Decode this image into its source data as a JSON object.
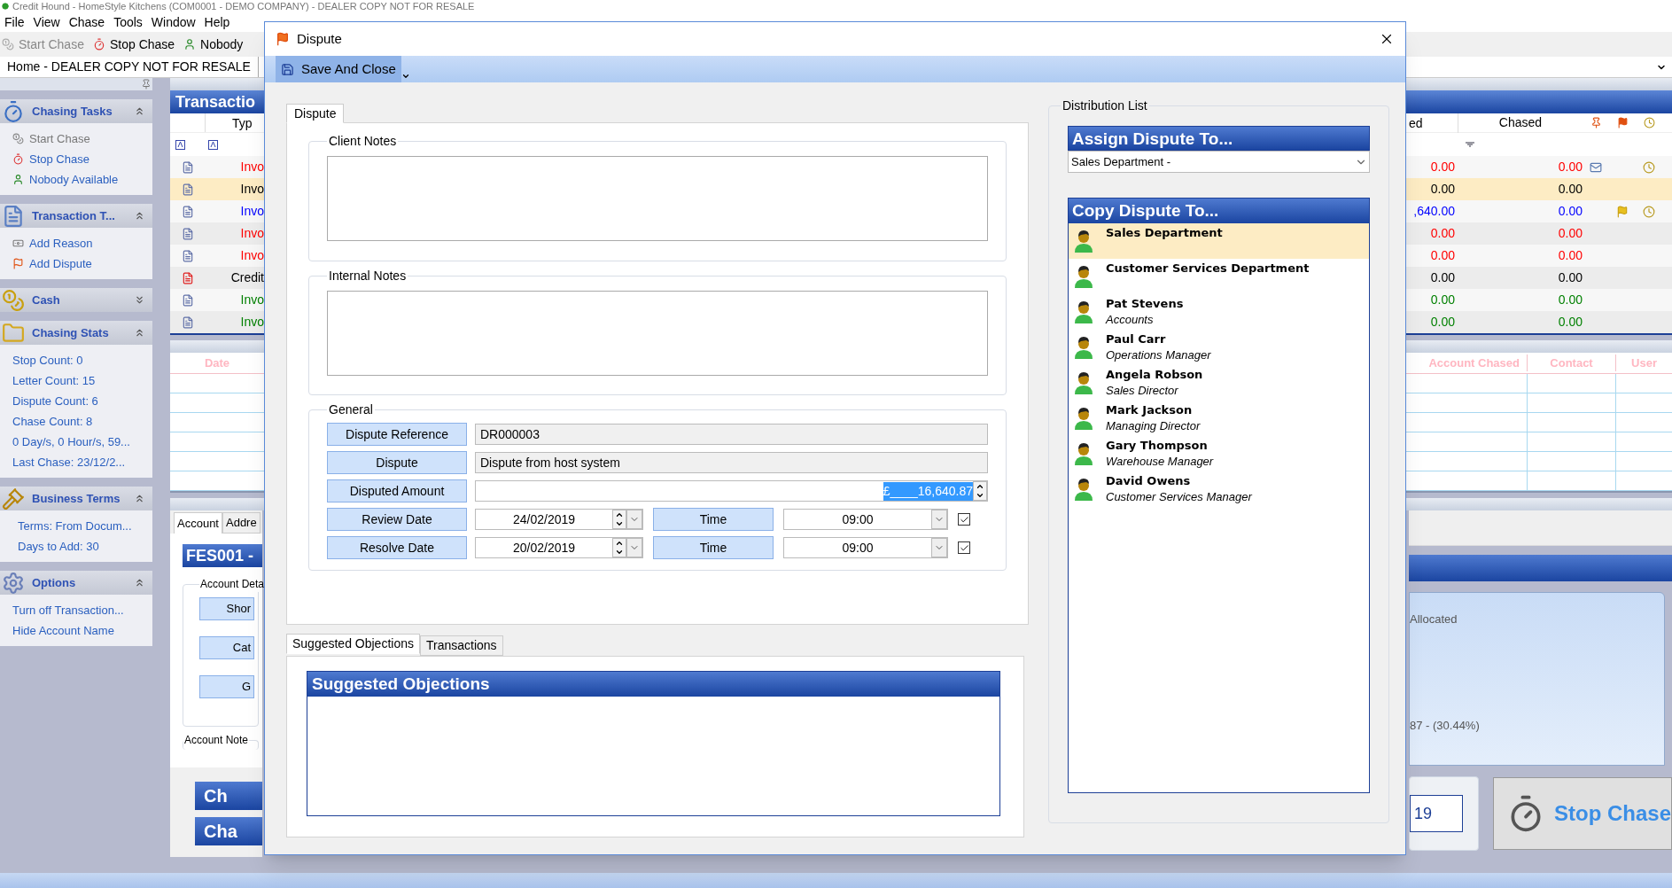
{
  "app_title": "Credit Hound - HomeStyle Kitchens (COM0001 - DEMO COMPANY) - DEALER COPY NOT FOR RESALE",
  "menu": [
    "File",
    "View",
    "Chase",
    "Tools",
    "Window",
    "Help"
  ],
  "toolbar": [
    {
      "label": "Start Chase",
      "disabled": true
    },
    {
      "label": "Stop Chase",
      "disabled": false
    },
    {
      "label": "Nobody",
      "disabled": false
    }
  ],
  "document_tab": "Home - DEALER COPY NOT FOR RESALE",
  "sidebar": [
    {
      "title": "Chasing Tasks",
      "expanded": true,
      "items": [
        {
          "label": "Start Chase",
          "disabled": true
        },
        {
          "label": "Stop Chase",
          "disabled": false
        },
        {
          "label": "Nobody Available",
          "disabled": false
        }
      ]
    },
    {
      "title": "Transaction  T...",
      "expanded": true,
      "items": [
        {
          "label": "Add Reason",
          "disabled": false
        },
        {
          "label": "Add Dispute",
          "disabled": false
        }
      ]
    },
    {
      "title": "Cash",
      "expanded": false
    },
    {
      "title": "Chasing Stats",
      "expanded": true,
      "items": [
        {
          "label": "Stop Count: 0",
          "disabled": false
        },
        {
          "label": "Letter Count: 15",
          "disabled": false
        },
        {
          "label": "Dispute Count: 6",
          "disabled": false
        },
        {
          "label": "Chase Count: 8",
          "disabled": false
        },
        {
          "label": "0 Day/s, 0 Hour/s, 59...",
          "disabled": false
        },
        {
          "label": "Last Chase: 23/12/2...",
          "disabled": false
        }
      ]
    },
    {
      "title": "Business Terms",
      "expanded": true,
      "items": [
        {
          "label": "Terms: From Docum...",
          "disabled": false
        },
        {
          "label": "Days to Add: 30",
          "disabled": false
        }
      ]
    },
    {
      "title": "Options",
      "expanded": true,
      "items": [
        {
          "label": "Turn off Transaction...",
          "disabled": false
        },
        {
          "label": "Hide Account Name",
          "disabled": false
        }
      ]
    }
  ],
  "transactions": {
    "title": "Transactio",
    "columns_left": [
      "Typ"
    ],
    "columns_right": [
      "ed",
      "Chased"
    ],
    "rows": [
      {
        "kind": "invoice",
        "type": "Invo",
        "amount": "0.00",
        "chased": "0.00",
        "color": "#ff0000",
        "selected": false,
        "emailed": true,
        "flagged": false,
        "reminder": true
      },
      {
        "kind": "invoice",
        "type": "Invo",
        "amount": "0.00",
        "chased": "0.00",
        "color": "#000000",
        "selected": true,
        "emailed": false,
        "flagged": false,
        "reminder": false
      },
      {
        "kind": "invoice",
        "type": "Invo",
        "amount": ",640.00",
        "chased": "0.00",
        "color": "#0000ff",
        "selected": false,
        "emailed": false,
        "flagged": true,
        "reminder": true
      },
      {
        "kind": "invoice",
        "type": "Invo",
        "amount": "0.00",
        "chased": "0.00",
        "color": "#ff0000",
        "selected": false,
        "emailed": false,
        "flagged": false,
        "reminder": false
      },
      {
        "kind": "invoice",
        "type": "Invo",
        "amount": "0.00",
        "chased": "0.00",
        "color": "#ff0000",
        "selected": false,
        "emailed": false,
        "flagged": false,
        "reminder": false
      },
      {
        "kind": "credit",
        "type": "Credit",
        "amount": "0.00",
        "chased": "0.00",
        "color": "#000000",
        "selected": false,
        "emailed": false,
        "flagged": false,
        "reminder": false
      },
      {
        "kind": "invoice",
        "type": "Invo",
        "amount": "0.00",
        "chased": "0.00",
        "color": "#008000",
        "selected": false,
        "emailed": false,
        "flagged": false,
        "reminder": false
      },
      {
        "kind": "invoice",
        "type": "Invo",
        "amount": "0.00",
        "chased": "0.00",
        "color": "#008000",
        "selected": false,
        "emailed": false,
        "flagged": false,
        "reminder": false
      }
    ]
  },
  "history": {
    "columns_left": [
      "Date"
    ],
    "columns_right": [
      "Account Chased",
      "Contact",
      "User"
    ]
  },
  "account": {
    "tabs": [
      {
        "label": "Account",
        "selected": true
      },
      {
        "label": "Addre",
        "selected": false
      }
    ],
    "header": "FES001 -",
    "group": "Account Deta",
    "fields": [
      "Shor",
      "Cat",
      "G"
    ],
    "notes_group": "Account Note",
    "buttons": [
      "Ch",
      "Cha"
    ],
    "allocated": "Allocated",
    "percent": "87 - (30.44%)",
    "date_box": "19",
    "stop_button": "Stop Chase"
  },
  "dialog": {
    "title": "Dispute",
    "toolbar_button": "Save And Close",
    "tabs": [
      {
        "label": "Dispute",
        "selected": true
      }
    ],
    "client_notes": "Client Notes",
    "internal_notes": "Internal Notes",
    "general": "General",
    "rows": [
      {
        "kind": "text",
        "label": "Dispute Reference",
        "value": "DR000003"
      },
      {
        "kind": "text",
        "label": "Dispute",
        "value": "Dispute from host system"
      },
      {
        "kind": "amount",
        "label": "Disputed Amount",
        "value": "£____16,640.87",
        "selected": true
      },
      {
        "kind": "date",
        "label": "Review Date",
        "value": "24/02/2019",
        "time_label": "Time",
        "time": "09:00",
        "checked": true
      },
      {
        "kind": "date",
        "label": "Resolve Date",
        "value": "20/02/2019",
        "time_label": "Time",
        "time": "09:00",
        "checked": true
      }
    ],
    "lower_tabs": [
      {
        "label": "Suggested Objections",
        "selected": true
      },
      {
        "label": "Transactions",
        "selected": false
      }
    ],
    "objections_title": "Suggested Objections",
    "distribution": {
      "label": "Distribution List",
      "assign_title": "Assign Dispute To...",
      "assign_value": "Sales Department -",
      "copy_title": "Copy Dispute To...",
      "people": [
        {
          "name": "Sales Department",
          "selected": true
        },
        {
          "name": "Customer Services Department",
          "selected": false
        },
        {
          "name": "Pat Stevens",
          "role": "Accounts",
          "selected": false
        },
        {
          "name": "Paul Carr",
          "role": "Operations Manager",
          "selected": false
        },
        {
          "name": "Angela Robson",
          "role": "Sales Director",
          "selected": false
        },
        {
          "name": "Mark Jackson",
          "role": "Managing Director",
          "selected": false
        },
        {
          "name": "Gary Thompson",
          "role": "Warehouse Manager",
          "selected": false
        },
        {
          "name": "David Owens",
          "role": "Customer Services Manager",
          "selected": false
        }
      ]
    }
  }
}
